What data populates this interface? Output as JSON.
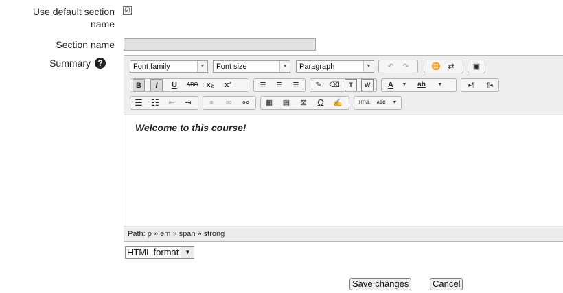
{
  "form": {
    "use_default_label_line1": "Use default section",
    "use_default_label_line2": "name",
    "use_default_checked": "☑",
    "section_name_label": "Section name",
    "section_name_value": "",
    "summary_label": "Summary",
    "help_icon": "?"
  },
  "editor": {
    "font_family": "Font family",
    "font_size": "Font size",
    "format": "Paragraph",
    "row1": {
      "undo": "↶",
      "redo": "↷",
      "find": "♊",
      "replace": "⇄",
      "fullscreen": "▣"
    },
    "row2": {
      "bold": "B",
      "italic": "I",
      "underline": "U",
      "strike": "ABC",
      "subscript": "x₂",
      "superscript": "x²",
      "align_left": "≡",
      "align_center": "≡",
      "align_right": "≡",
      "cleanup": "✎",
      "eraser": "⌫",
      "paste_text": "T",
      "paste_word": "W",
      "text_color": "A",
      "highlight": "ab",
      "ltr": "▸¶",
      "rtl": "¶◂"
    },
    "row3": {
      "bullets": "☰",
      "numbers": "☷",
      "outdent": "⇤",
      "indent": "⇥",
      "link": "⚭",
      "unlink": "⚮",
      "anchor": "⚯",
      "image": "▦",
      "media": "▤",
      "nonbreak": "⊠",
      "charmap": "Ω",
      "edit": "✍",
      "html": "HTML",
      "spell": "ABC"
    },
    "content_text": "Welcome to this course!",
    "path_text": "Path: p » em » span » strong"
  },
  "format_select": {
    "value": "HTML format"
  },
  "actions": {
    "save": "Save changes",
    "cancel": "Cancel"
  }
}
